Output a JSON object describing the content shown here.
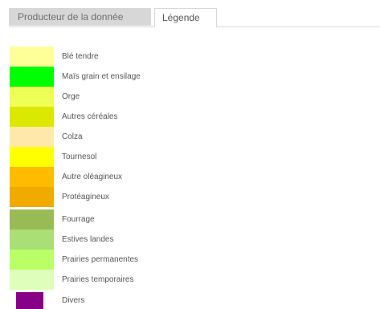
{
  "tabs": [
    {
      "label": "Producteur de la donnée",
      "active": false
    },
    {
      "label": "Légende",
      "active": true
    }
  ],
  "legend": [
    {
      "label": "Blé tendre",
      "color": "#ffff99"
    },
    {
      "label": "Maïs grain et ensilage",
      "color": "#00ff00"
    },
    {
      "label": "Orge",
      "color": "#eeff55"
    },
    {
      "label": "Autres céréales",
      "color": "#dde800"
    },
    {
      "label": "Colza",
      "color": "#ffe8aa"
    },
    {
      "label": "Tournesol",
      "color": "#ffff00"
    },
    {
      "label": "Autre oléagineux",
      "color": "#ffbb00"
    },
    {
      "label": "Protéagineux",
      "color": "#f0aa00"
    },
    {
      "label": "Fourrage",
      "color": "#99bb55"
    },
    {
      "label": "Estives landes",
      "color": "#aade77"
    },
    {
      "label": "Prairies permanentes",
      "color": "#bbff66"
    },
    {
      "label": "Prairies temporaires",
      "color": "#ddffbb"
    },
    {
      "label": "Divers",
      "color": "#880088"
    }
  ]
}
